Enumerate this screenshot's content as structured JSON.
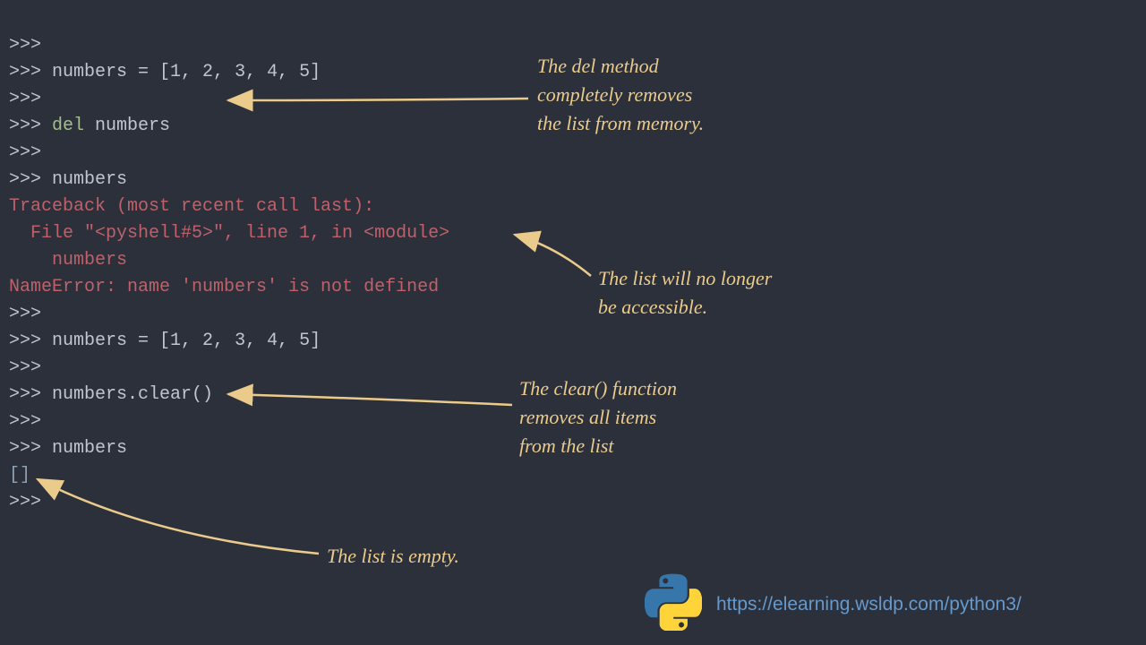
{
  "terminal": {
    "p": ">>>",
    "assign": "numbers = [1, 2, 3, 4, 5]",
    "del_kw": "del",
    "del_arg": " numbers",
    "call_numbers": "numbers",
    "tb1": "Traceback (most recent call last):",
    "tb2": "  File \"<pyshell#5>\", line 1, in <module>",
    "tb3": "    numbers",
    "tb4": "NameError: name 'numbers' is not defined",
    "assign2": "numbers = [1, 2, 3, 4, 5]",
    "clear_call": "numbers.clear()",
    "call_numbers2": "numbers",
    "empty_out": "[]"
  },
  "annotations": {
    "a1_l1": "The del method",
    "a1_l2": "completely removes",
    "a1_l3": "the list from memory.",
    "a2_l1": "The list will no longer",
    "a2_l2": "be accessible.",
    "a3_l1": "The clear() function",
    "a3_l2": "removes all items",
    "a3_l3": "from the list",
    "a4": "The list is empty."
  },
  "footer": {
    "url": "https://elearning.wsldp.com/python3/"
  },
  "colors": {
    "bg": "#2b303b",
    "text": "#c0c5ce",
    "keyword": "#a3be8c",
    "error": "#bf616a",
    "output": "#8fa1b3",
    "annotation": "#ebcb8b",
    "link": "#6699cc"
  }
}
